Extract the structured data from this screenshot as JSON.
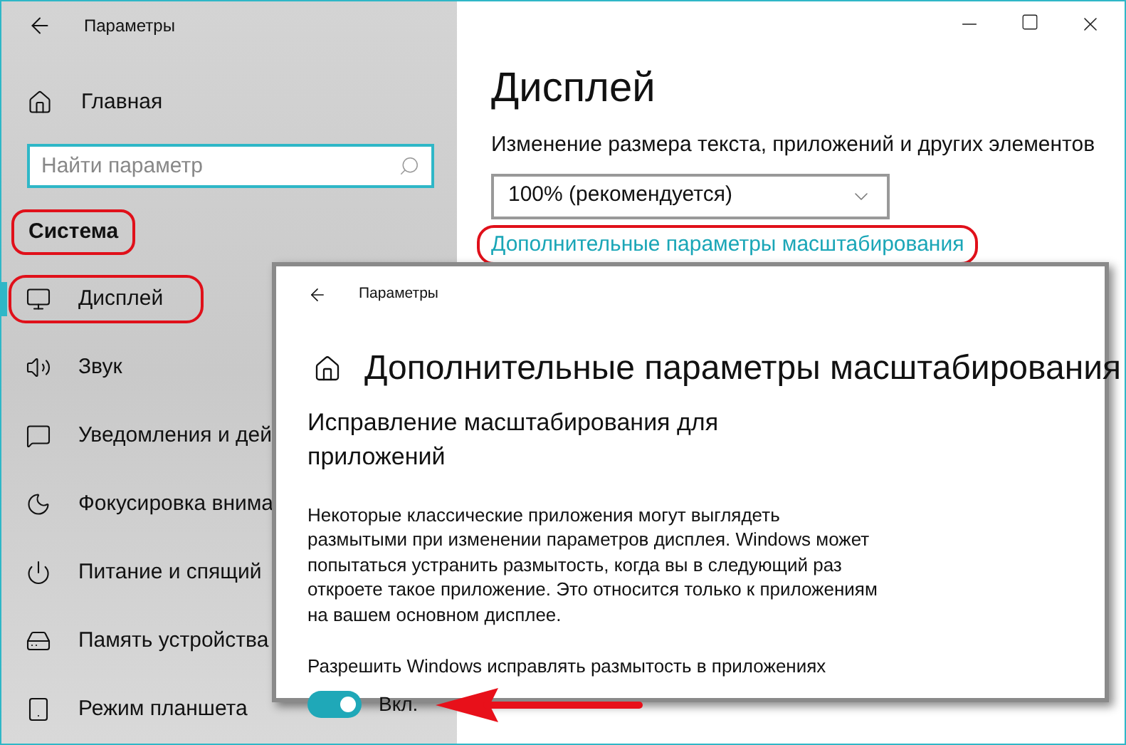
{
  "window": {
    "title": "Параметры"
  },
  "sidebar": {
    "home": "Главная",
    "search": {
      "placeholder": "Найти параметр"
    },
    "section": {
      "label": "Система",
      "annotated": true
    },
    "items": [
      {
        "label": "Дисплей",
        "selected": true,
        "annotated": true
      },
      {
        "label": "Звук",
        "selected": false,
        "annotated": false
      },
      {
        "label": "Уведомления и дей",
        "selected": false,
        "annotated": false
      },
      {
        "label": "Фокусировка внима",
        "selected": false,
        "annotated": false
      },
      {
        "label": "Питание и спящий",
        "selected": false,
        "annotated": false
      },
      {
        "label": "Память устройства",
        "selected": false,
        "annotated": false
      },
      {
        "label": "Режим планшета",
        "selected": false,
        "annotated": false
      }
    ]
  },
  "main": {
    "heading": "Дисплей",
    "scale_label": "Изменение размера текста, приложений и других элементов",
    "scale_dropdown": {
      "value": "100% (рекомендуется)"
    },
    "link": {
      "label": "Дополнительные параметры масштабирования",
      "annotated": true
    }
  },
  "overlay_window": {
    "title": "Параметры",
    "heading": "Дополнительные параметры масштабирования",
    "section_heading": "Исправление масштабирования для приложений",
    "description": "Некоторые классические приложения могут выглядеть размытыми при изменении параметров дисплея. Windows может попытаться устранить размытость, когда вы в следующий раз откроете такое приложение. Это относится только к приложениям на вашем основном дисплее.",
    "setting_label": "Разрешить Windows исправлять размытость в приложениях",
    "toggle": {
      "on": true,
      "state_label": "Вкл."
    },
    "annotation_arrow": true
  }
}
